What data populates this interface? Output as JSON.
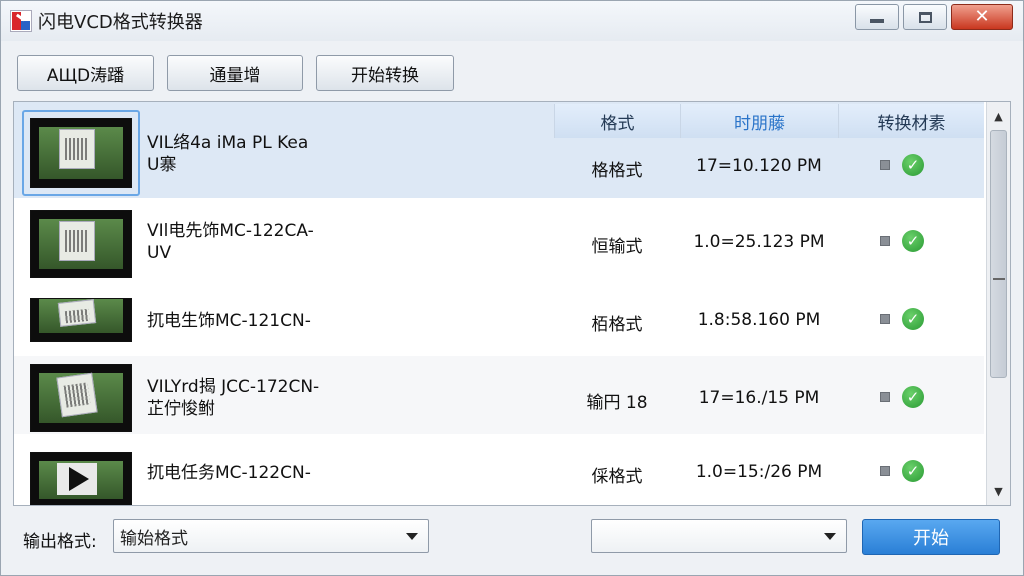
{
  "window": {
    "title": "闪电VCD格式转换器",
    "controls": [
      "minimize-icon",
      "maximize-icon",
      "close-icon"
    ]
  },
  "toolbar": {
    "add_label": "AЩD涛蹯",
    "batch_label": "通量增",
    "start_convert_label": "开始转换"
  },
  "columns": {
    "format": "格式",
    "time": "时朋藤",
    "status": "转换材素"
  },
  "rows": [
    {
      "name_line1": "VIL络4a iMa PL Kea",
      "name_line2": "U寨",
      "format": "格格式",
      "time": "17=10.120 PM",
      "thumb": "doc"
    },
    {
      "name_line1": "VIl电先饰MC-122CA-",
      "name_line2": "UV",
      "format": "恒输式",
      "time": "1.0=25.123 PM",
      "thumb": "doc"
    },
    {
      "name_line1": "扤电生饰MC-121CN-",
      "name_line2": "",
      "format": "栢格式",
      "time": "1.8:58.160 PM",
      "thumb": "doc"
    },
    {
      "name_line1": "VILYrd揭 JCC-172CN-",
      "name_line2": "芷佇悛鲋",
      "format": "输円 18",
      "time": "17=16.∕15 PM",
      "thumb": "doc"
    },
    {
      "name_line1": "扤电任务MC-122CN-",
      "name_line2": "",
      "format": "倸格式",
      "time": "1.0=15:∕26 PM",
      "thumb": "play"
    }
  ],
  "bottom": {
    "output_format_label": "输出格式:",
    "output_format_value": "输始格式",
    "second_select_value": "",
    "start_label": "开始"
  },
  "colors": {
    "accent": "#2a7fd6",
    "selected_row": "#dde8f5",
    "check_green": "#2a9a34"
  }
}
